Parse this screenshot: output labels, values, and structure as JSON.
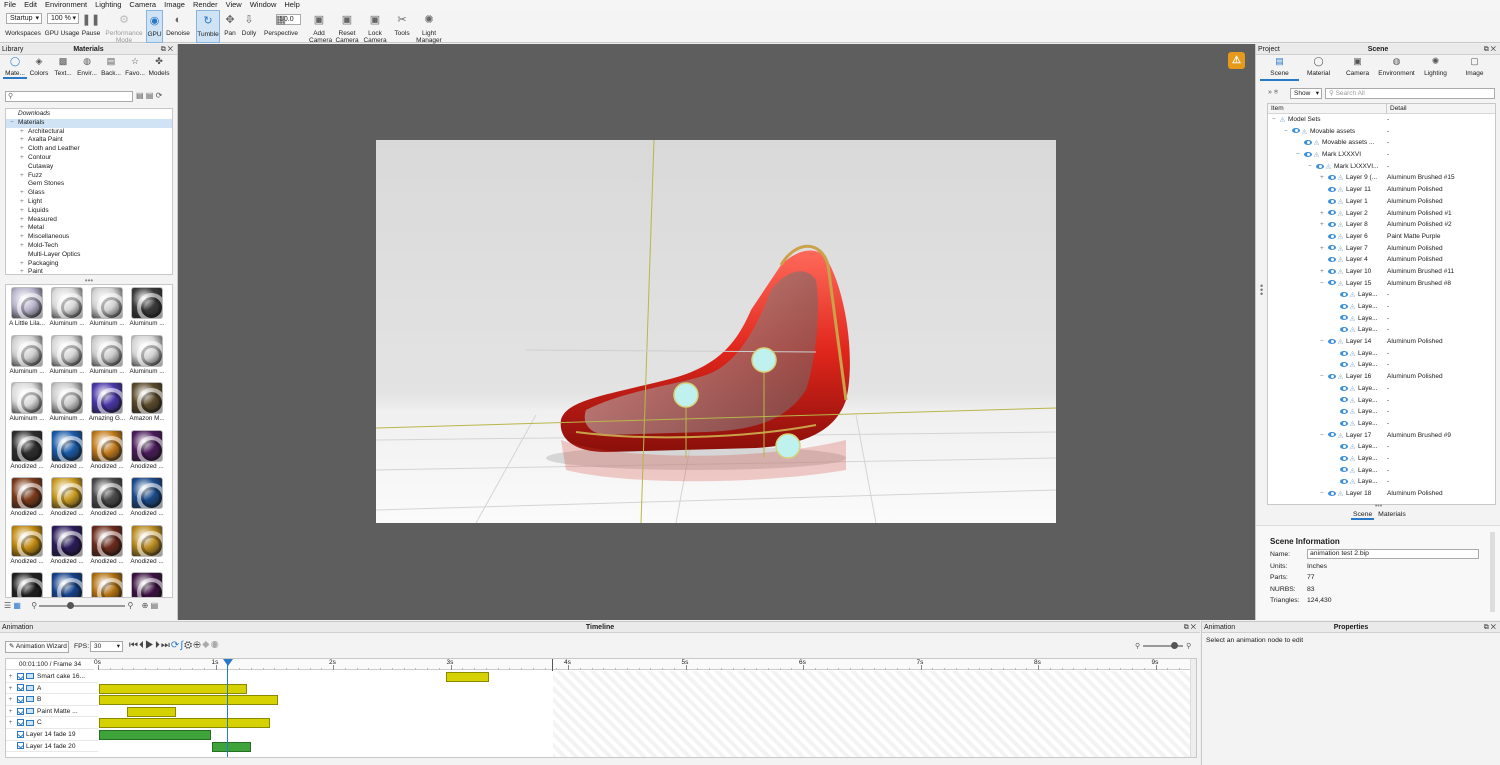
{
  "menu": [
    "File",
    "Edit",
    "Environment",
    "Lighting",
    "Camera",
    "Image",
    "Render",
    "View",
    "Window",
    "Help"
  ],
  "toolbar": {
    "workspace_value": "Startup",
    "zoom_value": "100 %",
    "fov_value": "50.0",
    "items": [
      {
        "label": "Workspaces",
        "icon": "workspaces-icon"
      },
      {
        "label": "GPU Usage",
        "icon": "gpu-usage-icon"
      },
      {
        "label": "Pause",
        "icon": "pause-icon",
        "glyph": "❚❚"
      },
      {
        "label": "Performance Mode",
        "icon": "performance-mode-icon",
        "glyph": "⚙"
      },
      {
        "label": "GPU",
        "icon": "gpu-icon",
        "glyph": "◉"
      },
      {
        "label": "Denoise",
        "icon": "denoise-icon",
        "glyph": "◐"
      },
      {
        "label": "Tumble",
        "icon": "tumble-icon",
        "glyph": "↻"
      },
      {
        "label": "Pan",
        "icon": "pan-icon",
        "glyph": "✥"
      },
      {
        "label": "Dolly",
        "icon": "dolly-icon",
        "glyph": "⇩"
      },
      {
        "label": "Perspective",
        "icon": "perspective-icon",
        "glyph": "▦"
      },
      {
        "label": "Add Camera",
        "icon": "add-camera-icon",
        "glyph": "▣"
      },
      {
        "label": "Reset Camera",
        "icon": "reset-camera-icon",
        "glyph": "▣"
      },
      {
        "label": "Lock Camera",
        "icon": "lock-camera-icon",
        "glyph": "▣"
      },
      {
        "label": "Tools",
        "icon": "tools-icon",
        "glyph": "✂"
      },
      {
        "label": "Light Manager",
        "icon": "light-manager-icon",
        "glyph": "✺"
      }
    ]
  },
  "library": {
    "panel_left": "Library",
    "title": "Materials",
    "tabs": [
      {
        "label": "Mate...",
        "icon": "materials-tab-icon",
        "glyph": "◯"
      },
      {
        "label": "Colors",
        "icon": "colors-tab-icon",
        "glyph": "◈"
      },
      {
        "label": "Text...",
        "icon": "textures-tab-icon",
        "glyph": "▩"
      },
      {
        "label": "Envir...",
        "icon": "environments-tab-icon",
        "glyph": "◍"
      },
      {
        "label": "Back...",
        "icon": "backplates-tab-icon",
        "glyph": "▤"
      },
      {
        "label": "Favo...",
        "icon": "favorites-tab-icon",
        "glyph": "☆"
      },
      {
        "label": "Models",
        "icon": "models-tab-icon",
        "glyph": "✤"
      }
    ],
    "search_placeholder": "",
    "tree": [
      {
        "label": "Downloads",
        "level": 0,
        "italic": true
      },
      {
        "label": "Materials",
        "level": 0,
        "selected": true,
        "expanded": true
      },
      {
        "label": "Architectural",
        "level": 1
      },
      {
        "label": "Axalta Paint",
        "level": 1
      },
      {
        "label": "Cloth and Leather",
        "level": 1
      },
      {
        "label": "Contour",
        "level": 1
      },
      {
        "label": "Cutaway",
        "level": 1,
        "leaf": true
      },
      {
        "label": "Fuzz",
        "level": 1
      },
      {
        "label": "Gem Stones",
        "level": 1,
        "leaf": true
      },
      {
        "label": "Glass",
        "level": 1
      },
      {
        "label": "Light",
        "level": 1
      },
      {
        "label": "Liquids",
        "level": 1
      },
      {
        "label": "Measured",
        "level": 1
      },
      {
        "label": "Metal",
        "level": 1
      },
      {
        "label": "Miscellaneous",
        "level": 1
      },
      {
        "label": "Mold-Tech",
        "level": 1
      },
      {
        "label": "Multi-Layer Optics",
        "level": 1,
        "leaf": true
      },
      {
        "label": "Packaging",
        "level": 1
      },
      {
        "label": "Paint",
        "level": 1
      }
    ],
    "thumbnails": [
      {
        "label": "A Little Lila...",
        "color": "#b9b4cc"
      },
      {
        "label": "Aluminum ...",
        "color": "#d8d8d8"
      },
      {
        "label": "Aluminum ...",
        "color": "#d2d2d2"
      },
      {
        "label": "Aluminum ...",
        "color": "#3a3a3a"
      },
      {
        "label": "Aluminum ...",
        "color": "#cfcfcf"
      },
      {
        "label": "Aluminum ...",
        "color": "#d6d6d6"
      },
      {
        "label": "Aluminum ...",
        "color": "#cccccc"
      },
      {
        "label": "Aluminum ...",
        "color": "#d4d4d4"
      },
      {
        "label": "Aluminum ...",
        "color": "#d9d9d9"
      },
      {
        "label": "Aluminum ...",
        "color": "#c9c9c9"
      },
      {
        "label": "Amazing G...",
        "color": "#4a36a8"
      },
      {
        "label": "Amazon M...",
        "color": "#5a4a2a"
      },
      {
        "label": "Anodized ...",
        "color": "#2e2e2e"
      },
      {
        "label": "Anodized ...",
        "color": "#1a5aa8"
      },
      {
        "label": "Anodized ...",
        "color": "#c07a1a"
      },
      {
        "label": "Anodized ...",
        "color": "#4a1a5a"
      },
      {
        "label": "Anodized ...",
        "color": "#7a3a1a"
      },
      {
        "label": "Anodized ...",
        "color": "#c89a20"
      },
      {
        "label": "Anodized ...",
        "color": "#4a4a4a"
      },
      {
        "label": "Anodized ...",
        "color": "#1a4a8a"
      },
      {
        "label": "Anodized ...",
        "color": "#c08a10"
      },
      {
        "label": "Anodized ...",
        "color": "#2a1a5a"
      },
      {
        "label": "Anodized ...",
        "color": "#6a2a1a"
      },
      {
        "label": "Anodized ...",
        "color": "#b88a20"
      },
      {
        "label": "Anodized ...",
        "color": "#1e1e1e"
      },
      {
        "label": "Anodized ...",
        "color": "#14408a"
      },
      {
        "label": "Anodized ...",
        "color": "#b07010"
      },
      {
        "label": "Anodized ...",
        "color": "#3a1040"
      }
    ]
  },
  "project": {
    "panel_left": "Project",
    "title": "Scene",
    "tabs": [
      {
        "label": "Scene",
        "icon": "scene-tab-icon",
        "glyph": "▤"
      },
      {
        "label": "Material",
        "icon": "material-tab-icon",
        "glyph": "◯"
      },
      {
        "label": "Camera",
        "icon": "camera-tab-icon",
        "glyph": "▣"
      },
      {
        "label": "Environment",
        "icon": "environment-tab-icon",
        "glyph": "◍"
      },
      {
        "label": "Lighting",
        "icon": "lighting-tab-icon",
        "glyph": "✺"
      },
      {
        "label": "Image",
        "icon": "image-tab-icon",
        "glyph": "▢"
      }
    ],
    "show_label": "Show",
    "search_placeholder": "Search All",
    "col_item": "Item",
    "col_detail": "Detail",
    "rows": [
      {
        "name": "Model Sets",
        "detail": "-",
        "level": 0,
        "exp": "−",
        "eye": false
      },
      {
        "name": "Movable assets",
        "detail": "-",
        "level": 1,
        "exp": "−",
        "eye": true
      },
      {
        "name": "Movable assets ...",
        "detail": "-",
        "level": 2,
        "exp": "",
        "eye": true
      },
      {
        "name": "Mark LXXXVI",
        "detail": "-",
        "level": 2,
        "exp": "−",
        "eye": true
      },
      {
        "name": "Mark LXXXVI...",
        "detail": "-",
        "level": 3,
        "exp": "−",
        "eye": true
      },
      {
        "name": "Layer 9 (...",
        "detail": "Aluminum Brushed #15",
        "level": 4,
        "exp": "+",
        "eye": true
      },
      {
        "name": "Layer 11",
        "detail": "Aluminum Polished",
        "level": 4,
        "exp": "",
        "eye": true
      },
      {
        "name": "Layer 1",
        "detail": "Aluminum Polished",
        "level": 4,
        "exp": "",
        "eye": true
      },
      {
        "name": "Layer 2",
        "detail": "Aluminum Polished #1",
        "level": 4,
        "exp": "+",
        "eye": true
      },
      {
        "name": "Layer 8",
        "detail": "Aluminum Polished #2",
        "level": 4,
        "exp": "+",
        "eye": true
      },
      {
        "name": "Layer 6",
        "detail": "Paint Matte Purple",
        "level": 4,
        "exp": "",
        "eye": true
      },
      {
        "name": "Layer 7",
        "detail": "Aluminum Polished",
        "level": 4,
        "exp": "+",
        "eye": true
      },
      {
        "name": "Layer 4",
        "detail": "Aluminum Polished",
        "level": 4,
        "exp": "",
        "eye": true
      },
      {
        "name": "Layer 10",
        "detail": "Aluminum Brushed #11",
        "level": 4,
        "exp": "+",
        "eye": true
      },
      {
        "name": "Layer 15",
        "detail": "Aluminum Brushed #8",
        "level": 4,
        "exp": "−",
        "eye": true
      },
      {
        "name": "Laye...",
        "detail": "-",
        "level": 5,
        "exp": "",
        "eye": true
      },
      {
        "name": "Laye...",
        "detail": "-",
        "level": 5,
        "exp": "",
        "eye": true
      },
      {
        "name": "Laye...",
        "detail": "-",
        "level": 5,
        "exp": "",
        "eye": true
      },
      {
        "name": "Laye...",
        "detail": "-",
        "level": 5,
        "exp": "",
        "eye": true
      },
      {
        "name": "Layer 14",
        "detail": "Aluminum Polished",
        "level": 4,
        "exp": "−",
        "eye": true
      },
      {
        "name": "Laye...",
        "detail": "-",
        "level": 5,
        "exp": "",
        "eye": true
      },
      {
        "name": "Laye...",
        "detail": "-",
        "level": 5,
        "exp": "",
        "eye": true
      },
      {
        "name": "Layer 16",
        "detail": "Aluminum Polished",
        "level": 4,
        "exp": "−",
        "eye": true
      },
      {
        "name": "Laye...",
        "detail": "-",
        "level": 5,
        "exp": "",
        "eye": true
      },
      {
        "name": "Laye...",
        "detail": "-",
        "level": 5,
        "exp": "",
        "eye": true
      },
      {
        "name": "Laye...",
        "detail": "-",
        "level": 5,
        "exp": "",
        "eye": true
      },
      {
        "name": "Laye...",
        "detail": "-",
        "level": 5,
        "exp": "",
        "eye": true
      },
      {
        "name": "Layer 17",
        "detail": "Aluminum Brushed #9",
        "level": 4,
        "exp": "−",
        "eye": true
      },
      {
        "name": "Laye...",
        "detail": "-",
        "level": 5,
        "exp": "",
        "eye": true
      },
      {
        "name": "Laye...",
        "detail": "-",
        "level": 5,
        "exp": "",
        "eye": true
      },
      {
        "name": "Laye...",
        "detail": "-",
        "level": 5,
        "exp": "",
        "eye": true
      },
      {
        "name": "Laye...",
        "detail": "-",
        "level": 5,
        "exp": "",
        "eye": true
      },
      {
        "name": "Layer 18",
        "detail": "Aluminum Polished",
        "level": 4,
        "exp": "−",
        "eye": true
      }
    ],
    "subtabs": [
      "Scene",
      "Materials"
    ],
    "info": {
      "title": "Scene Information",
      "name_label": "Name:",
      "name_value": "animation test 2.bip",
      "units_label": "Units:",
      "units_value": "Inches",
      "parts_label": "Parts:",
      "parts_value": "77",
      "nurbs_label": "NURBS:",
      "nurbs_value": "83",
      "triangles_label": "Triangles:",
      "triangles_value": "124,430"
    }
  },
  "animation": {
    "panel_left": "Animation",
    "title": "Timeline",
    "wizard_label": "Animation Wizard",
    "fps_label": "FPS:",
    "fps_value": "30",
    "time_readout": "00:01:100 / Frame 34",
    "ruler": [
      "0s",
      "1s",
      "2s",
      "3s",
      "4s",
      "5s",
      "6s",
      "7s",
      "8s",
      "9s"
    ],
    "tracks": [
      {
        "name": "Smart cake 16...",
        "exp": "+",
        "node": true
      },
      {
        "name": "A",
        "exp": "+",
        "node": true
      },
      {
        "name": "B",
        "exp": "+",
        "node": true
      },
      {
        "name": "Paint Matte ...",
        "exp": "+",
        "node": true
      },
      {
        "name": "C",
        "exp": "+",
        "node": true
      },
      {
        "name": "Layer 14 fade 19",
        "exp": "",
        "node": false
      },
      {
        "name": "Layer 14 fade 20",
        "exp": "",
        "node": false
      }
    ]
  },
  "properties": {
    "panel_left": "Animation",
    "title": "Properties",
    "hint": "Select an animation node to edit"
  }
}
